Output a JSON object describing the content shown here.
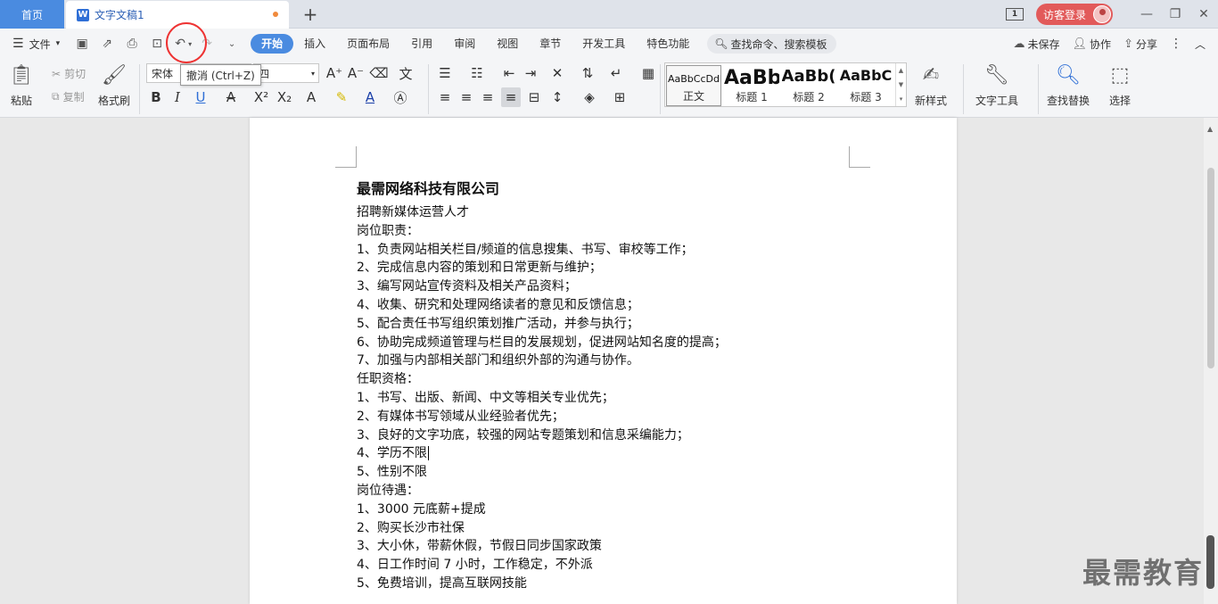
{
  "tabs": {
    "home": "首页",
    "document": "文字文稿1"
  },
  "titlebar": {
    "page_badge": "1",
    "login": "访客登录"
  },
  "menubar": {
    "file": "文件",
    "tabs": [
      "开始",
      "插入",
      "页面布局",
      "引用",
      "审阅",
      "视图",
      "章节",
      "开发工具",
      "特色功能"
    ],
    "search_placeholder": "查找命令、搜索模板",
    "unsaved": "未保存",
    "collab": "协作",
    "share": "分享"
  },
  "tooltip": {
    "undo": "撤消 (Ctrl+Z)"
  },
  "ribbon": {
    "paste": "粘贴",
    "cut": "剪切",
    "copy": "复制",
    "format_painter": "格式刷",
    "font_name": "宋体",
    "font_size": "四",
    "styles": [
      {
        "sample": "AaBbCcDd",
        "label": "正文"
      },
      {
        "sample": "AaBb",
        "label": "标题 1"
      },
      {
        "sample": "AaBb(",
        "label": "标题 2"
      },
      {
        "sample": "AaBbC",
        "label": "标题 3"
      }
    ],
    "new_style": "新样式",
    "text_tools": "文字工具",
    "find_replace": "查找替换",
    "select": "选择"
  },
  "document": {
    "title": "最需网络科技有限公司",
    "lines": [
      "招聘新媒体运营人才",
      "岗位职责：",
      "1、负责网站相关栏目/频道的信息搜集、书写、审校等工作；",
      "2、完成信息内容的策划和日常更新与维护；",
      "3、编写网站宣传资料及相关产品资料；",
      "4、收集、研究和处理网络读者的意见和反馈信息；",
      "5、配合责任书写组织策划推广活动，并参与执行；",
      "6、协助完成频道管理与栏目的发展规划，促进网站知名度的提高；",
      "7、加强与内部相关部门和组织外部的沟通与协作。",
      "任职资格：",
      "1、书写、出版、新闻、中文等相关专业优先；",
      "2、有媒体书写领域从业经验者优先；",
      "3、良好的文字功底，较强的网站专题策划和信息采编能力；",
      "4、学历不限",
      "5、性别不限",
      "岗位待遇：",
      "1、3000 元底薪+提成",
      "2、购买长沙市社保",
      "3、大小休，带薪休假，节假日同步国家政策",
      "4、日工作时间 7 小时，工作稳定，不外派",
      "5、免费培训，提高互联网技能"
    ]
  },
  "watermark": "最需教育"
}
